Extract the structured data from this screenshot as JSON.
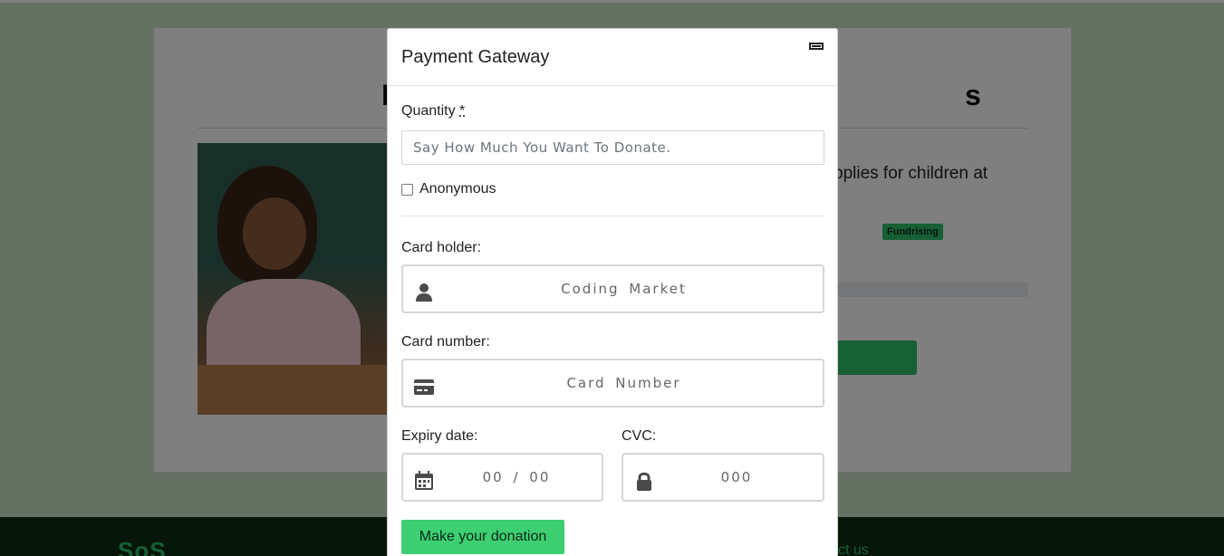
{
  "background": {
    "card": {
      "title_start": "D",
      "title_end": "s",
      "description": "pplies for children at",
      "badge": "Fundrising"
    },
    "footer": {
      "logo": "SoS",
      "link": "ct us"
    }
  },
  "modal": {
    "title": "Payment Gateway",
    "quantity": {
      "label": "Quantity",
      "required_mark": "*",
      "placeholder": "Say How Much You Want To Donate."
    },
    "anonymous_label": "Anonymous",
    "card_holder": {
      "label": "Card holder:",
      "placeholder": "Coding  Market",
      "icon": "user-icon"
    },
    "card_number": {
      "label": "Card number:",
      "placeholder": "Card  Number",
      "icon": "credit-card-icon"
    },
    "expiry": {
      "label": "Expiry date:",
      "placeholder": "00  /  00",
      "icon": "calendar-icon"
    },
    "cvc": {
      "label": "CVC:",
      "placeholder": "000",
      "icon": "lock-icon"
    },
    "submit_label": "Make your donation"
  },
  "colors": {
    "accent": "#3dcf72",
    "footer_bg": "#0c2f12",
    "page_bg": "#c9e3c6"
  }
}
